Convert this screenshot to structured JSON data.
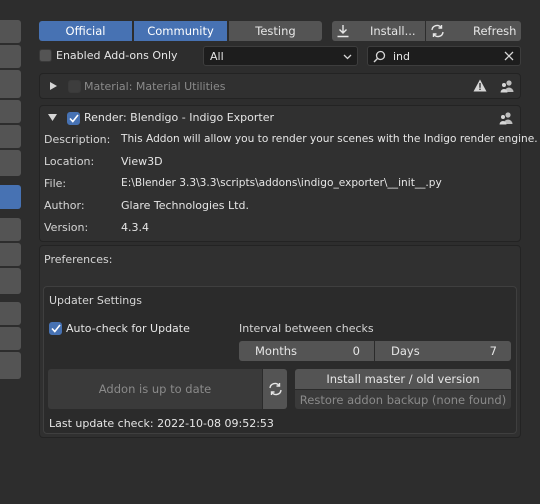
{
  "header": {
    "tabs": [
      {
        "label": "Official",
        "active": true
      },
      {
        "label": "Community",
        "active": true
      },
      {
        "label": "Testing",
        "active": false
      }
    ],
    "install_label": "Install...",
    "refresh_label": "Refresh"
  },
  "filters": {
    "enabled_only_label": "Enabled Add-ons Only",
    "enabled_only_checked": false,
    "category_value": "All",
    "search_value": "ind"
  },
  "addons": [
    {
      "name": "Material: Material Utilities",
      "enabled": false,
      "expanded": false,
      "icons": [
        "warning-icon",
        "community-icon"
      ]
    },
    {
      "name": "Render: Blendigo - Indigo Exporter",
      "enabled": true,
      "expanded": true,
      "details": {
        "description_key": "Description:",
        "description": "This Addon will allow you to render your scenes with the Indigo render engine.",
        "location_key": "Location:",
        "location": "View3D",
        "file_key": "File:",
        "file": "E:\\Blender 3.3\\3.3\\scripts\\addons\\indigo_exporter\\__init__.py",
        "author_key": "Author:",
        "author": "Glare Technologies Ltd.",
        "version_key": "Version:",
        "version": "4.3.4"
      }
    }
  ],
  "preferences": {
    "title": "Preferences:",
    "updater": {
      "title": "Updater Settings",
      "auto_check_label": "Auto-check for Update",
      "auto_check_checked": true,
      "interval_label": "Interval between checks",
      "months_label": "Months",
      "months_value": "0",
      "days_label": "Days",
      "days_value": "7",
      "status_button": "Addon is up to date",
      "install_button": "Install master / old version",
      "restore_button": "Restore addon backup (none found)",
      "last_check": "Last update check: 2022-10-08 09:52:53"
    }
  },
  "colors": {
    "accent": "#4772b3",
    "background": "#2d2d2d",
    "button": "#545454",
    "panel": "#303030",
    "field": "#1d1d1d"
  }
}
